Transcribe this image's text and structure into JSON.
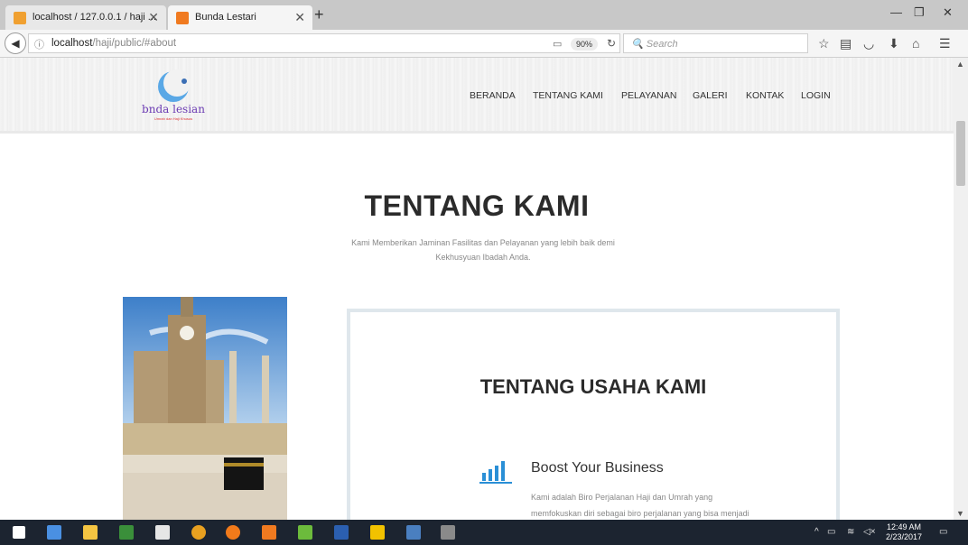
{
  "browser": {
    "tabs": [
      {
        "title": "localhost / 127.0.0.1 / haji ..."
      },
      {
        "title": "Bunda Lestari"
      }
    ],
    "url_host": "localhost",
    "url_path": "/haji/public/#about",
    "zoom": "90%",
    "search_placeholder": "Search"
  },
  "site": {
    "logo_text": "bnda lesian",
    "logo_tagline": "Umrah dan Haji Khusus",
    "menu": [
      "BERANDA",
      "TENTANG KAMI",
      "PELAYANAN",
      "GALERI",
      "KONTAK",
      "LOGIN"
    ]
  },
  "about": {
    "title": "TENTANG KAMI",
    "subtitle_line1": "Kami Memberikan Jaminan Fasilitas dan Pelayanan yang lebih baik demi",
    "subtitle_line2": "Kekhusyuan Ibadah Anda.",
    "card_title": "TENTANG USAHA KAMI",
    "feature_title": "Boost Your Business",
    "feature_line1": "Kami adalah Biro Perjalanan Haji dan Umrah yang",
    "feature_line2": "memfokuskan diri sebagai biro perjalanan yang bisa menjadi"
  },
  "taskbar": {
    "time": "12:49 AM",
    "date": "2/23/2017"
  },
  "colors": {
    "accent_blue": "#2a8fd6",
    "logo_purple": "#6c3cb3"
  }
}
